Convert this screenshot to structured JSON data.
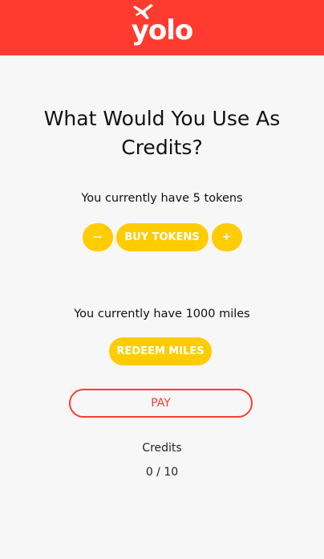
{
  "header": {
    "logo_text": "yolo",
    "brand_color": "#ff3b30"
  },
  "main": {
    "title_line1": "What Would You Use As",
    "title_line2": "Credits?",
    "tokens_text": "You currently have 5 tokens",
    "decrement_label": "--",
    "buy_tokens_label": "BUY TOKENS",
    "increment_label": "+",
    "miles_text": "You currently have 1000 miles",
    "redeem_label": "REDEEM MILES",
    "pay_label": "PAY",
    "credits_label": "Credits",
    "credits_value": "0 / 10"
  },
  "colors": {
    "accent_yellow": "#ffcc00",
    "accent_red": "#ff3b30",
    "background": "#f7f7f7"
  }
}
